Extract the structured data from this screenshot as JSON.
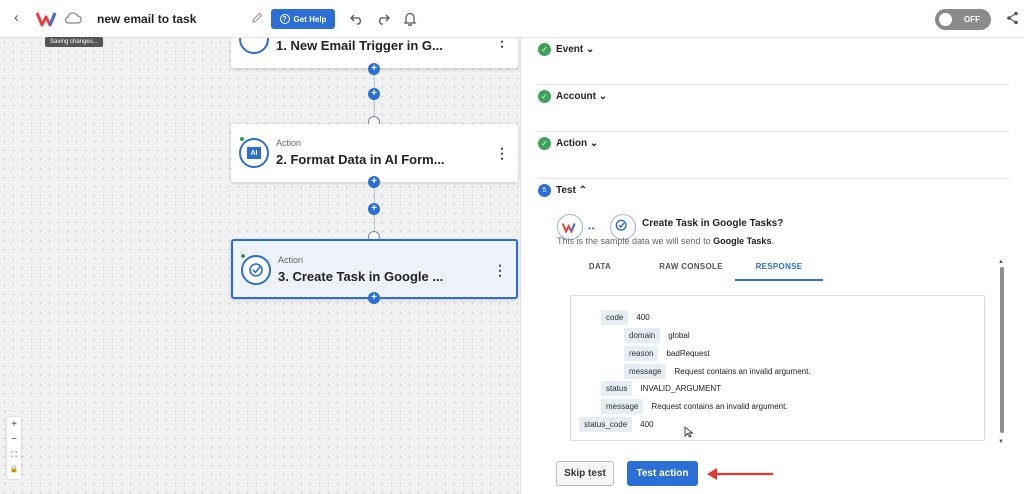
{
  "header": {
    "workflow_title": "new email to task",
    "saving_text": "Saving changes...",
    "help_label": "Get Help",
    "toggle_label": "OFF"
  },
  "canvas": {
    "nodes": [
      {
        "type": "",
        "name": "1. New Email Trigger in G..."
      },
      {
        "type": "Action",
        "name": "2. Format Data in AI Form...",
        "icon_text": "AI"
      },
      {
        "type": "Action",
        "name": "3. Create Task in Google ..."
      }
    ],
    "zoom_controls": [
      "+",
      "−",
      "⛶",
      "🔒"
    ]
  },
  "panel": {
    "sections": [
      {
        "label": "Event"
      },
      {
        "label": "Account"
      },
      {
        "label": "Action"
      }
    ],
    "test": {
      "step_number": "5",
      "label": "Test",
      "question": "Create Task in Google Tasks?",
      "sample_prefix": "This is the sample data we will send to",
      "sample_target": "Google Tasks",
      "sample_suffix": ".",
      "tabs": [
        "DATA",
        "RAW CONSOLE",
        "RESPONSE"
      ],
      "active_tab": "RESPONSE",
      "response": [
        {
          "key": "code",
          "value": "400"
        },
        {
          "key": "domain",
          "value": "global"
        },
        {
          "key": "reason",
          "value": "badRequest"
        },
        {
          "key": "message",
          "value": "Request contains an invalid argument."
        },
        {
          "key": "status",
          "value": "INVALID_ARGUMENT"
        },
        {
          "key": "message",
          "value": "Request contains an invalid argument."
        },
        {
          "key": "status_code",
          "value": "400"
        }
      ],
      "skip_label": "Skip test",
      "test_label": "Test action"
    }
  },
  "colors": {
    "accent": "#2b6fd6",
    "success": "#3ea35a",
    "annotation_arrow": "#e03a2b"
  }
}
